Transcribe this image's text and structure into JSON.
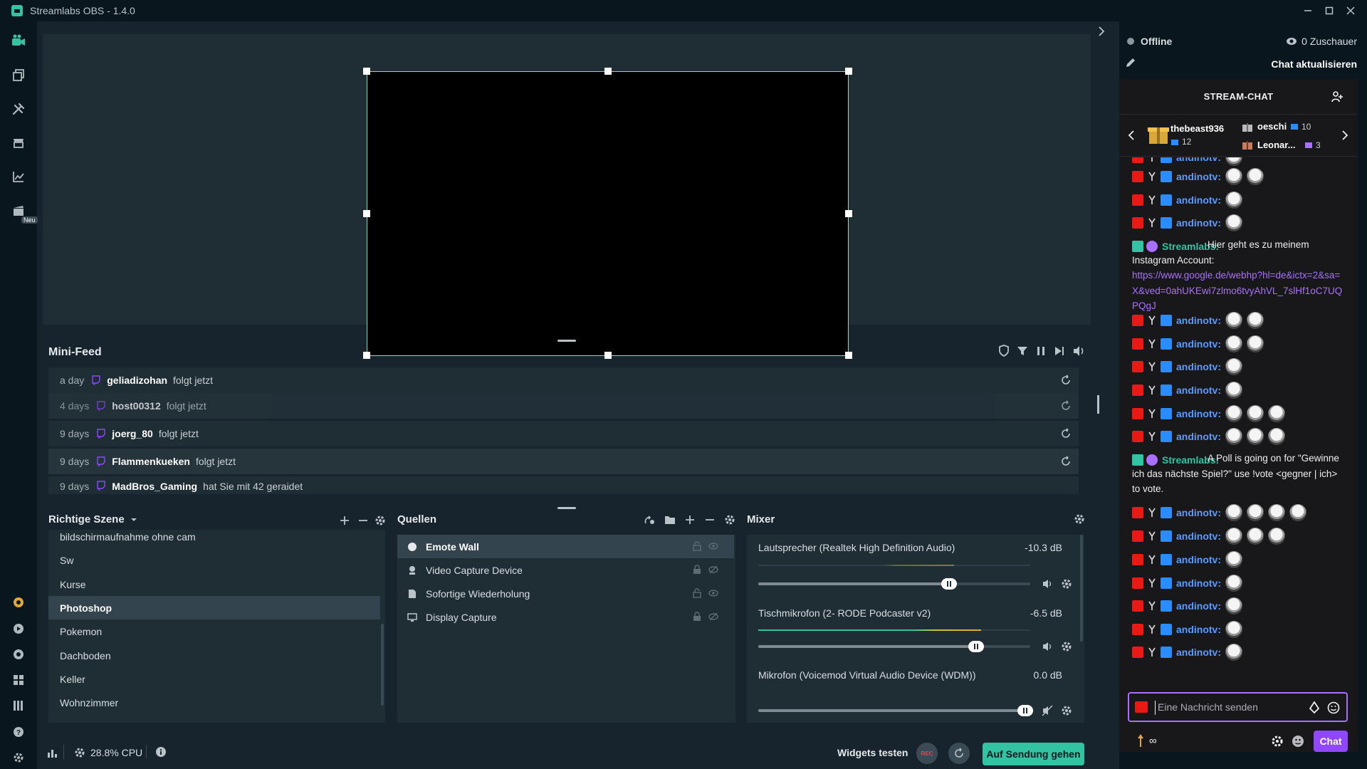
{
  "window": {
    "title": "Streamlabs OBS - 1.4.0"
  },
  "nav": {
    "new_badge": "Neu"
  },
  "minifeed": {
    "title": "Mini-Feed",
    "rows": [
      {
        "time": "a day",
        "user": "geliadizohan",
        "action": "folgt jetzt"
      },
      {
        "time": "4 days",
        "user": "host00312",
        "action": "folgt jetzt"
      },
      {
        "time": "9 days",
        "user": "joerg_80",
        "action": "folgt jetzt"
      },
      {
        "time": "9 days",
        "user": "Flammenkueken",
        "action": "folgt jetzt"
      },
      {
        "time": "9 days",
        "user": "MadBros_Gaming",
        "action": "hat Sie mit 42 geraidet"
      }
    ]
  },
  "scenes": {
    "title": "Richtige Szene",
    "items": [
      "bildschirmaufnahme ohne cam",
      "Sw",
      "Kurse",
      "Photoshop",
      "Pokemon",
      "Dachboden",
      "Keller",
      "Wohnzimmer"
    ],
    "active": "Photoshop"
  },
  "sources": {
    "title": "Quellen",
    "items": [
      {
        "name": "Emote Wall",
        "icon": "globe-icon"
      },
      {
        "name": "Video Capture Device",
        "icon": "webcam-icon"
      },
      {
        "name": "Sofortige Wiederholung",
        "icon": "file-icon"
      },
      {
        "name": "Display Capture",
        "icon": "monitor-icon"
      }
    ]
  },
  "mixer": {
    "title": "Mixer",
    "channels": [
      {
        "name": "Lautsprecher (Realtek High Definition Audio)",
        "db": "-10.3 dB",
        "level": 0.72
      },
      {
        "name": "Tischmikrofon (2- RODE Podcaster v2)",
        "db": "-6.5 dB",
        "level": 0.82
      },
      {
        "name": "Mikrofon (Voicemod Virtual Audio Device (WDM))",
        "db": "0.0 dB",
        "level": 1.0
      }
    ]
  },
  "footer": {
    "cpu": "28.8% CPU",
    "test_widgets": "Widgets testen",
    "rec": "REC",
    "go_live": "Auf Sendung gehen"
  },
  "right": {
    "status": "Offline",
    "viewers": "0 Zuschauer",
    "refresh_chat": "Chat aktualisieren"
  },
  "chat": {
    "header": "STREAM-CHAT",
    "gifters": [
      {
        "name": "thebeast936",
        "count": "12"
      },
      {
        "name": "oeschi",
        "count": "10"
      },
      {
        "name": "Leonar...",
        "count": "3"
      }
    ],
    "user_main": "andinotv:",
    "user_bot": "Streamlabs:",
    "msg1": "Hier geht es zu meinem Instagram Account:",
    "msg1_link": "https://www.google.de/webhp?hl=de&ictx=2&sa=X&ved=0ahUKEwi7zlmo6tvyAhVL_7slHf1oC7UQPQgJ",
    "msg2": "A Poll is going on for \"Gewinne ich das nächste Spiel?\" use !vote <gegner | ich> to vote.",
    "input_placeholder": "Eine Nachricht senden",
    "infinity": "∞",
    "send": "Chat"
  },
  "colors": {
    "accent": "#31c3a2",
    "twitch": "#9147ff",
    "link": "#a970ff",
    "bg": "#17242d"
  }
}
